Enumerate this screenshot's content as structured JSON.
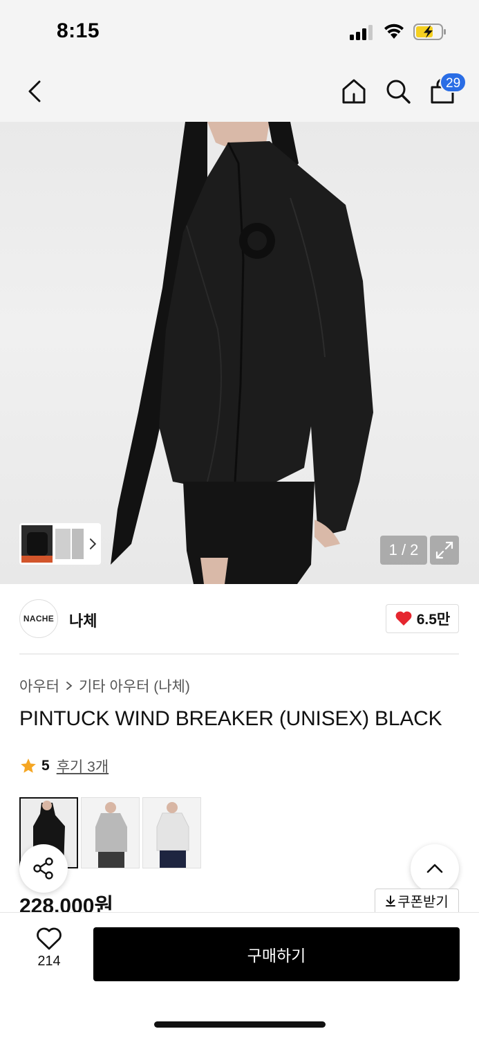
{
  "status": {
    "time": "8:15"
  },
  "nav": {
    "cart_count": "29"
  },
  "gallery": {
    "page_indicator": "1 / 2"
  },
  "brand": {
    "logo_text": "NACHE",
    "name": "나체",
    "likes": "6.5만"
  },
  "product": {
    "breadcrumb": [
      "아우터",
      "기타 아우터 (나체)"
    ],
    "title": "PINTUCK WIND BREAKER (UNISEX) BLACK",
    "rating": "5",
    "reviews": "후기 3개",
    "price": "228,000원",
    "coupon_label": "쿠폰받기"
  },
  "bottom": {
    "wish_count": "214",
    "buy_label": "구매하기"
  },
  "colors": {
    "accent_badge": "#2a6de5",
    "heart": "#e5262f",
    "star": "#f5a623",
    "buy_button": "#000000"
  }
}
